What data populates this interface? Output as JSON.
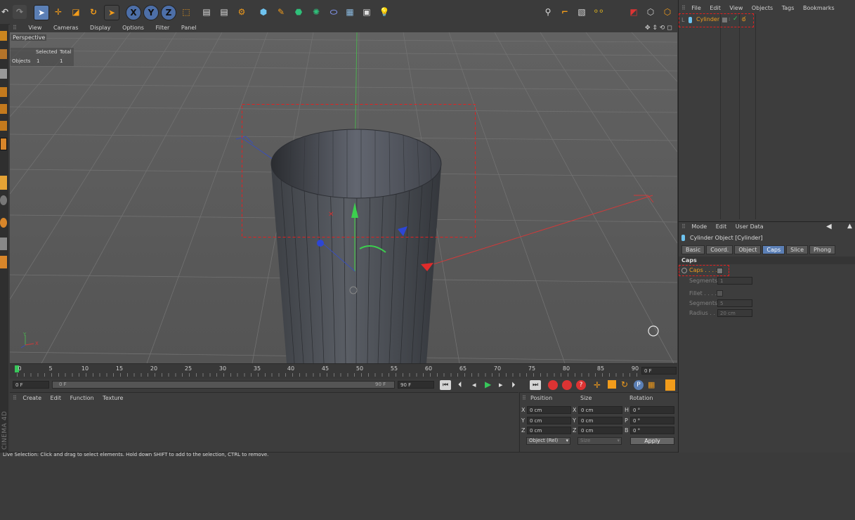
{
  "viewport_menu": [
    "View",
    "Cameras",
    "Display",
    "Options",
    "Filter",
    "Panel"
  ],
  "viewport": {
    "name": "Perspective",
    "stats": {
      "h_selected": "Selected",
      "h_total": "Total",
      "row": "Objects",
      "selected": "1",
      "total": "1"
    }
  },
  "om_menu": [
    "File",
    "Edit",
    "View",
    "Objects",
    "Tags",
    "Bookmarks"
  ],
  "object_manager": {
    "object": "Cylinder"
  },
  "am_menu": [
    "Mode",
    "Edit",
    "User Data"
  ],
  "attributes": {
    "title": "Cylinder Object [Cylinder]",
    "tabs": [
      "Basic",
      "Coord.",
      "Object",
      "Caps",
      "Slice",
      "Phong"
    ],
    "active_tab": "Caps",
    "section": "Caps",
    "caps_label": "Caps . . . .",
    "seg1_label": "Segments",
    "seg1_value": "1",
    "fillet_label": "Fillet . . . .",
    "seg2_label": "Segments",
    "seg2_value": "5",
    "radius_label": "Radius . .",
    "radius_value": "20 cm"
  },
  "timeline": {
    "ticks": [
      "0",
      "5",
      "10",
      "15",
      "20",
      "25",
      "30",
      "35",
      "40",
      "45",
      "50",
      "55",
      "60",
      "65",
      "70",
      "75",
      "80",
      "85",
      "90"
    ],
    "frame_display": "0 F",
    "start": "0 F",
    "range_start": "0 F",
    "range_end": "90 F",
    "end": "90 F"
  },
  "material_menu": [
    "Create",
    "Edit",
    "Function",
    "Texture"
  ],
  "coords": {
    "headers": {
      "position": "Position",
      "size": "Size",
      "rotation": "Rotation"
    },
    "rows": [
      {
        "axis": "X",
        "pos": "0 cm",
        "size_axis": "X",
        "size": "0 cm",
        "rot_axis": "H",
        "rot": "0 °"
      },
      {
        "axis": "Y",
        "pos": "0 cm",
        "size_axis": "Y",
        "size": "0 cm",
        "rot_axis": "P",
        "rot": "0 °"
      },
      {
        "axis": "Z",
        "pos": "0 cm",
        "size_axis": "Z",
        "size": "0 cm",
        "rot_axis": "B",
        "rot": "0 °"
      }
    ],
    "mode": "Object (Rel)",
    "size_mode": "Size",
    "apply": "Apply"
  },
  "brand": "CINEMA 4D",
  "status": "Live Selection: Click and drag to select elements. Hold down SHIFT to add to the selection, CTRL to remove.",
  "colors": {
    "accent": "#f29c1b",
    "selection": "#e32020",
    "active_tab": "#5b7fb5",
    "viewport_bg": "#5c5c5c"
  },
  "icons": [
    "undo-icon",
    "redo-icon",
    "live-selection-icon",
    "move-icon",
    "scale-icon",
    "rotate-icon",
    "recent-tool-icon",
    "x-axis-icon",
    "y-axis-icon",
    "z-axis-icon",
    "world-coordinate-icon",
    "render-view-icon",
    "render-to-picture-viewer-icon",
    "render-settings-icon",
    "cube-icon",
    "pen-icon",
    "subdivision-icon",
    "array-icon",
    "deformer-icon",
    "floor-icon",
    "camera-icon",
    "light-icon",
    "magnet-icon",
    "snap-icon",
    "workplane-icon",
    "axis-modifier-icon",
    "layout-icon",
    "solo-icon",
    "layer-icon"
  ]
}
